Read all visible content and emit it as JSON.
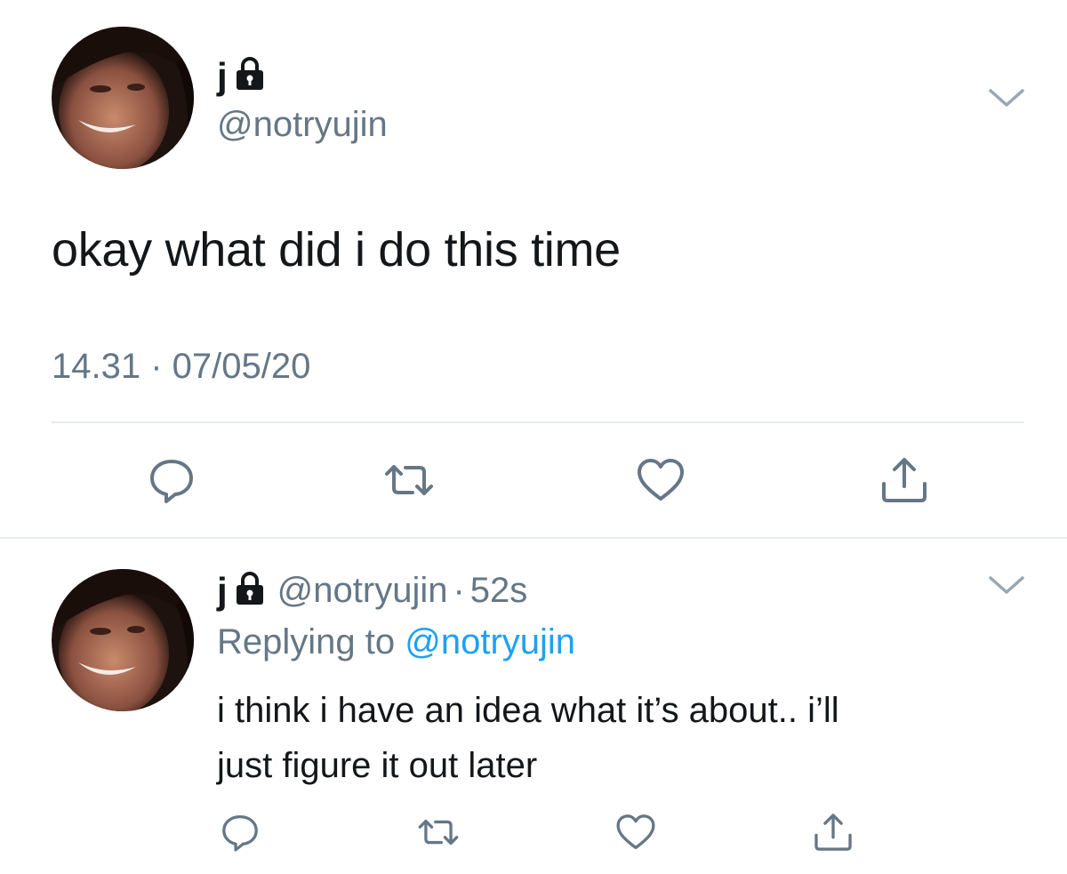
{
  "tweet": {
    "display_name": "j",
    "handle": "@notryujin",
    "text": "okay what did i do this time",
    "timestamp": "14.31 · 07/05/20",
    "icons": [
      "lock-icon",
      "chevron-down-icon",
      "reply-icon",
      "retweet-icon",
      "like-icon",
      "share-icon"
    ]
  },
  "reply": {
    "display_name": "j",
    "handle": "@notryujin",
    "separator": "·",
    "time": "52s",
    "replying_prefix": "Replying to",
    "replying_to": "@notryujin",
    "text_line1": "i think i have an idea what it’s about.. i’ll",
    "text_line2": "just figure it out later"
  },
  "colors": {
    "text": "#14171a",
    "secondary": "#657786",
    "link": "#1da1f2",
    "divider": "#e6ecf0"
  }
}
